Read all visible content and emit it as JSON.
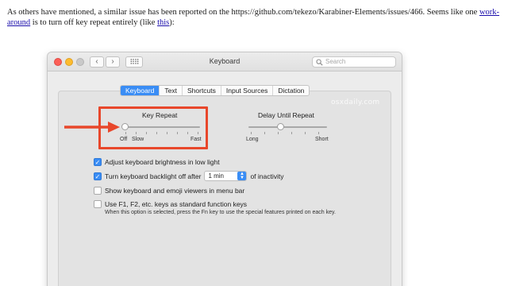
{
  "intro": {
    "text_before_link": "As others have mentioned, a similar issue has been reported on the https://github.com/tekezo/Karabiner-Elements/issues/466. Seems like one ",
    "link1": "work-around",
    "text_middle": " is to turn off key repeat entirely (like ",
    "link2": "this",
    "text_after": "):"
  },
  "window": {
    "title": "Keyboard",
    "search_placeholder": "Search",
    "back_glyph": "‹",
    "forward_glyph": "›",
    "grid_glyph": "⠿⠿"
  },
  "tabs": [
    "Keyboard",
    "Text",
    "Shortcuts",
    "Input Sources",
    "Dictation"
  ],
  "active_tab": "Keyboard",
  "watermark": "osxdaily.com",
  "key_repeat": {
    "label": "Key Repeat",
    "min_label_off": "Off",
    "min_label_slow": "Slow",
    "max_label": "Fast",
    "value_fraction": 0.0
  },
  "delay_until_repeat": {
    "label": "Delay Until Repeat",
    "min_label": "Long",
    "max_label": "Short",
    "value_fraction": 0.4
  },
  "options": [
    {
      "label": "Adjust keyboard brightness in low light",
      "checked": true
    },
    {
      "label_before": "Turn keyboard backlight off after",
      "popup_value": "1 min",
      "label_after": "of inactivity",
      "checked": true
    },
    {
      "label": "Show keyboard and emoji viewers in menu bar",
      "checked": false
    },
    {
      "label": "Use F1, F2, etc. keys as standard function keys",
      "checked": false
    }
  ],
  "fn_note": "When this option is selected, press the Fn key to use the special features printed on each key.",
  "colors": {
    "accent": "#3a8df5",
    "annotation": "#e8472b"
  }
}
